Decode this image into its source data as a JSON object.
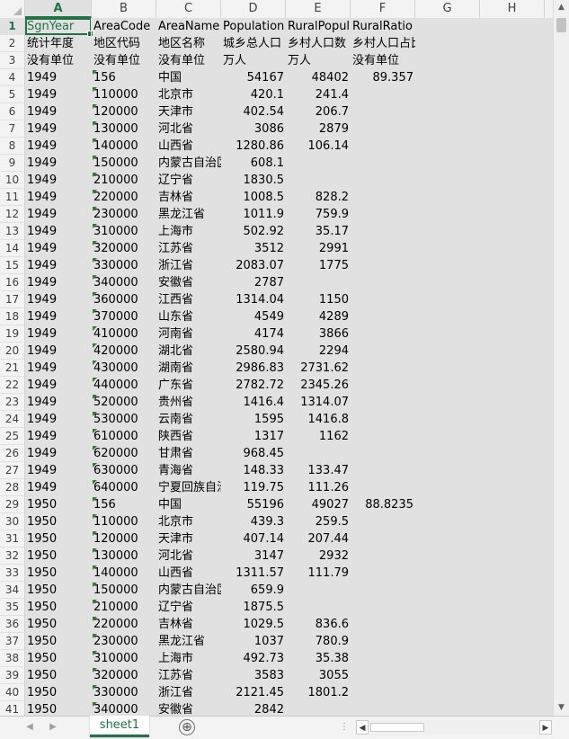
{
  "sheet": {
    "name": "sheet1",
    "add_symbol": "⊕",
    "active_cell": "A1"
  },
  "columns": [
    "A",
    "B",
    "C",
    "D",
    "E",
    "F",
    "G",
    "H"
  ],
  "rows": [
    [
      "SgnYear",
      "AreaCode",
      "AreaName",
      "Population",
      "RuralPopul",
      "RuralRatio"
    ],
    [
      "统计年度",
      "地区代码",
      "地区名称",
      "城乡总人口",
      "乡村人口数",
      "乡村人口占比(%)"
    ],
    [
      "没有单位",
      "没有单位",
      "没有单位",
      "万人",
      "万人",
      "没有单位"
    ],
    [
      "1949",
      "156",
      "中国",
      "54167",
      "48402",
      "89.357"
    ],
    [
      "1949",
      "110000",
      "北京市",
      "420.1",
      "241.4",
      ""
    ],
    [
      "1949",
      "120000",
      "天津市",
      "402.54",
      "206.7",
      ""
    ],
    [
      "1949",
      "130000",
      "河北省",
      "3086",
      "2879",
      ""
    ],
    [
      "1949",
      "140000",
      "山西省",
      "1280.86",
      "106.14",
      ""
    ],
    [
      "1949",
      "150000",
      "内蒙古自治区",
      "608.1",
      "",
      ""
    ],
    [
      "1949",
      "210000",
      "辽宁省",
      "1830.5",
      "",
      ""
    ],
    [
      "1949",
      "220000",
      "吉林省",
      "1008.5",
      "828.2",
      ""
    ],
    [
      "1949",
      "230000",
      "黑龙江省",
      "1011.9",
      "759.9",
      ""
    ],
    [
      "1949",
      "310000",
      "上海市",
      "502.92",
      "35.17",
      ""
    ],
    [
      "1949",
      "320000",
      "江苏省",
      "3512",
      "2991",
      ""
    ],
    [
      "1949",
      "330000",
      "浙江省",
      "2083.07",
      "1775",
      ""
    ],
    [
      "1949",
      "340000",
      "安徽省",
      "2787",
      "",
      ""
    ],
    [
      "1949",
      "360000",
      "江西省",
      "1314.04",
      "1150",
      ""
    ],
    [
      "1949",
      "370000",
      "山东省",
      "4549",
      "4289",
      ""
    ],
    [
      "1949",
      "410000",
      "河南省",
      "4174",
      "3866",
      ""
    ],
    [
      "1949",
      "420000",
      "湖北省",
      "2580.94",
      "2294",
      ""
    ],
    [
      "1949",
      "430000",
      "湖南省",
      "2986.83",
      "2731.62",
      ""
    ],
    [
      "1949",
      "440000",
      "广东省",
      "2782.72",
      "2345.26",
      ""
    ],
    [
      "1949",
      "520000",
      "贵州省",
      "1416.4",
      "1314.07",
      ""
    ],
    [
      "1949",
      "530000",
      "云南省",
      "1595",
      "1416.8",
      ""
    ],
    [
      "1949",
      "610000",
      "陕西省",
      "1317",
      "1162",
      ""
    ],
    [
      "1949",
      "620000",
      "甘肃省",
      "968.45",
      "",
      ""
    ],
    [
      "1949",
      "630000",
      "青海省",
      "148.33",
      "133.47",
      ""
    ],
    [
      "1949",
      "640000",
      "宁夏回族自治区",
      "119.75",
      "111.26",
      ""
    ],
    [
      "1950",
      "156",
      "中国",
      "55196",
      "49027",
      "88.8235"
    ],
    [
      "1950",
      "110000",
      "北京市",
      "439.3",
      "259.5",
      ""
    ],
    [
      "1950",
      "120000",
      "天津市",
      "407.14",
      "207.44",
      ""
    ],
    [
      "1950",
      "130000",
      "河北省",
      "3147",
      "2932",
      ""
    ],
    [
      "1950",
      "140000",
      "山西省",
      "1311.57",
      "111.79",
      ""
    ],
    [
      "1950",
      "150000",
      "内蒙古自治区",
      "659.9",
      "",
      ""
    ],
    [
      "1950",
      "210000",
      "辽宁省",
      "1875.5",
      "",
      ""
    ],
    [
      "1950",
      "220000",
      "吉林省",
      "1029.5",
      "836.6",
      ""
    ],
    [
      "1950",
      "230000",
      "黑龙江省",
      "1037",
      "780.9",
      ""
    ],
    [
      "1950",
      "310000",
      "上海市",
      "492.73",
      "35.38",
      ""
    ],
    [
      "1950",
      "320000",
      "江苏省",
      "3583",
      "3055",
      ""
    ],
    [
      "1950",
      "330000",
      "浙江省",
      "2121.45",
      "1801.2",
      ""
    ],
    [
      "1950",
      "340000",
      "安徽省",
      "2842",
      "",
      ""
    ]
  ],
  "colors": {
    "accent": "#217346",
    "flag": "#2e7d32",
    "gridline": "#e1e1e1",
    "header_bg": "#f3f3f3"
  },
  "icons": {
    "first_sheet": "first-sheet-arrow-icon",
    "prev_sheet": "prev-sheet-arrow-icon",
    "add_sheet": "plus-circle-icon",
    "scroll_up": "scroll-up-icon",
    "scroll_down": "scroll-down-icon",
    "scroll_left": "scroll-left-icon",
    "scroll_right": "scroll-right-icon"
  }
}
